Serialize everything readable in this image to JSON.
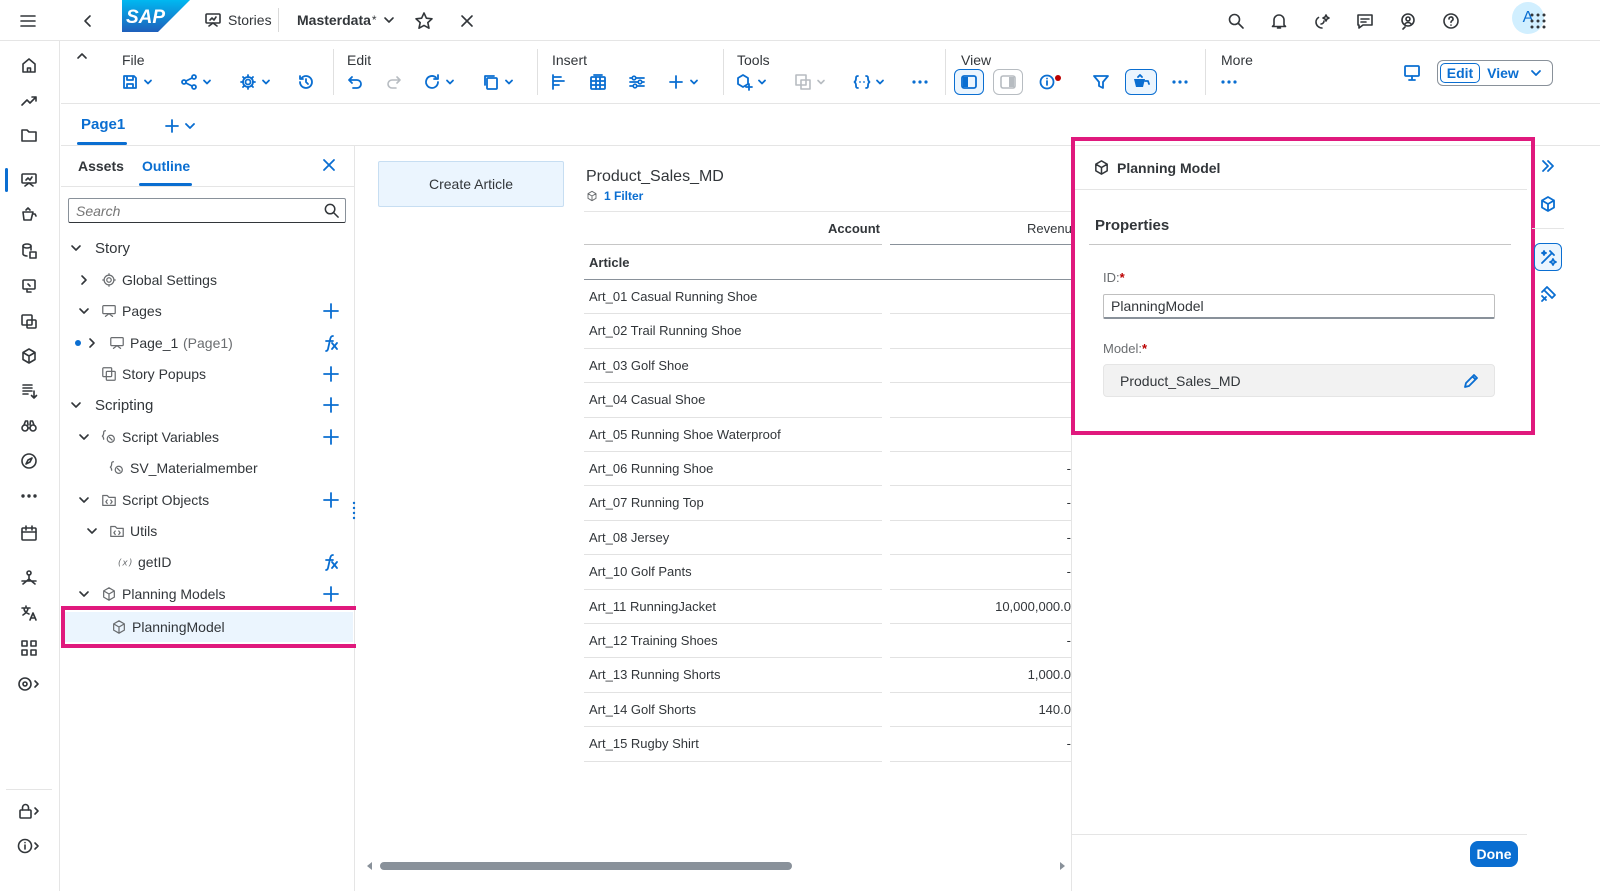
{
  "shell": {
    "stories_label": "Stories",
    "story_title": "Masterdata",
    "modified_marker": "*",
    "avatar_initial": "A"
  },
  "toolbar": {
    "groups": {
      "file": "File",
      "edit": "Edit",
      "insert": "Insert",
      "tools": "Tools",
      "view": "View",
      "more": "More"
    },
    "edit_mode_label": "Edit",
    "view_mode_label": "View"
  },
  "page_tabs": {
    "active": "Page1"
  },
  "outline": {
    "tabs": {
      "assets": "Assets",
      "outline": "Outline"
    },
    "search_placeholder": "Search",
    "tree": {
      "story": "Story",
      "global_settings": "Global Settings",
      "pages": "Pages",
      "page_1": "Page_1",
      "page_1_suffix": "(Page1)",
      "story_popups": "Story Popups",
      "scripting": "Scripting",
      "script_variables": "Script Variables",
      "sv_materialmember": "SV_Materialmember",
      "script_objects": "Script Objects",
      "utils": "Utils",
      "getid": "getID",
      "planning_models": "Planning Models",
      "planning_model": "PlanningModel"
    }
  },
  "canvas": {
    "create_button": "Create Article",
    "table": {
      "title": "Product_Sales_MD",
      "filter": "1 Filter",
      "account_header": "Account",
      "measure_header": "Revenu",
      "row_header": "Article",
      "rows": [
        {
          "article": "Art_01 Casual Running Shoe",
          "value": ""
        },
        {
          "article": "Art_02 Trail Running Shoe",
          "value": ""
        },
        {
          "article": "Art_03 Golf Shoe",
          "value": ""
        },
        {
          "article": "Art_04 Casual Shoe",
          "value": ""
        },
        {
          "article": "Art_05 Running Shoe Waterproof",
          "value": ""
        },
        {
          "article": "Art_06 Running Shoe",
          "value": "-"
        },
        {
          "article": "Art_07 Running Top",
          "value": "-"
        },
        {
          "article": "Art_08 Jersey",
          "value": "-"
        },
        {
          "article": "Art_10 Golf Pants",
          "value": "-"
        },
        {
          "article": "Art_11 RunningJacket",
          "value": "10,000,000.0"
        },
        {
          "article": "Art_12 Training Shoes",
          "value": "-"
        },
        {
          "article": "Art_13 Running Shorts",
          "value": "1,000.0"
        },
        {
          "article": "Art_14 Golf Shorts",
          "value": "140.0"
        },
        {
          "article": "Art_15 Rugby Shirt",
          "value": "-"
        }
      ]
    }
  },
  "panel": {
    "title": "Planning Model",
    "section": "Properties",
    "id_label": "ID:",
    "id_value": "PlanningModel",
    "model_label": "Model:",
    "model_value": "Product_Sales_MD",
    "required_marker": "*",
    "done_button": "Done"
  },
  "colors": {
    "accent": "#0a6ed1",
    "highlight": "#e0197d",
    "required": "#bb0000"
  }
}
